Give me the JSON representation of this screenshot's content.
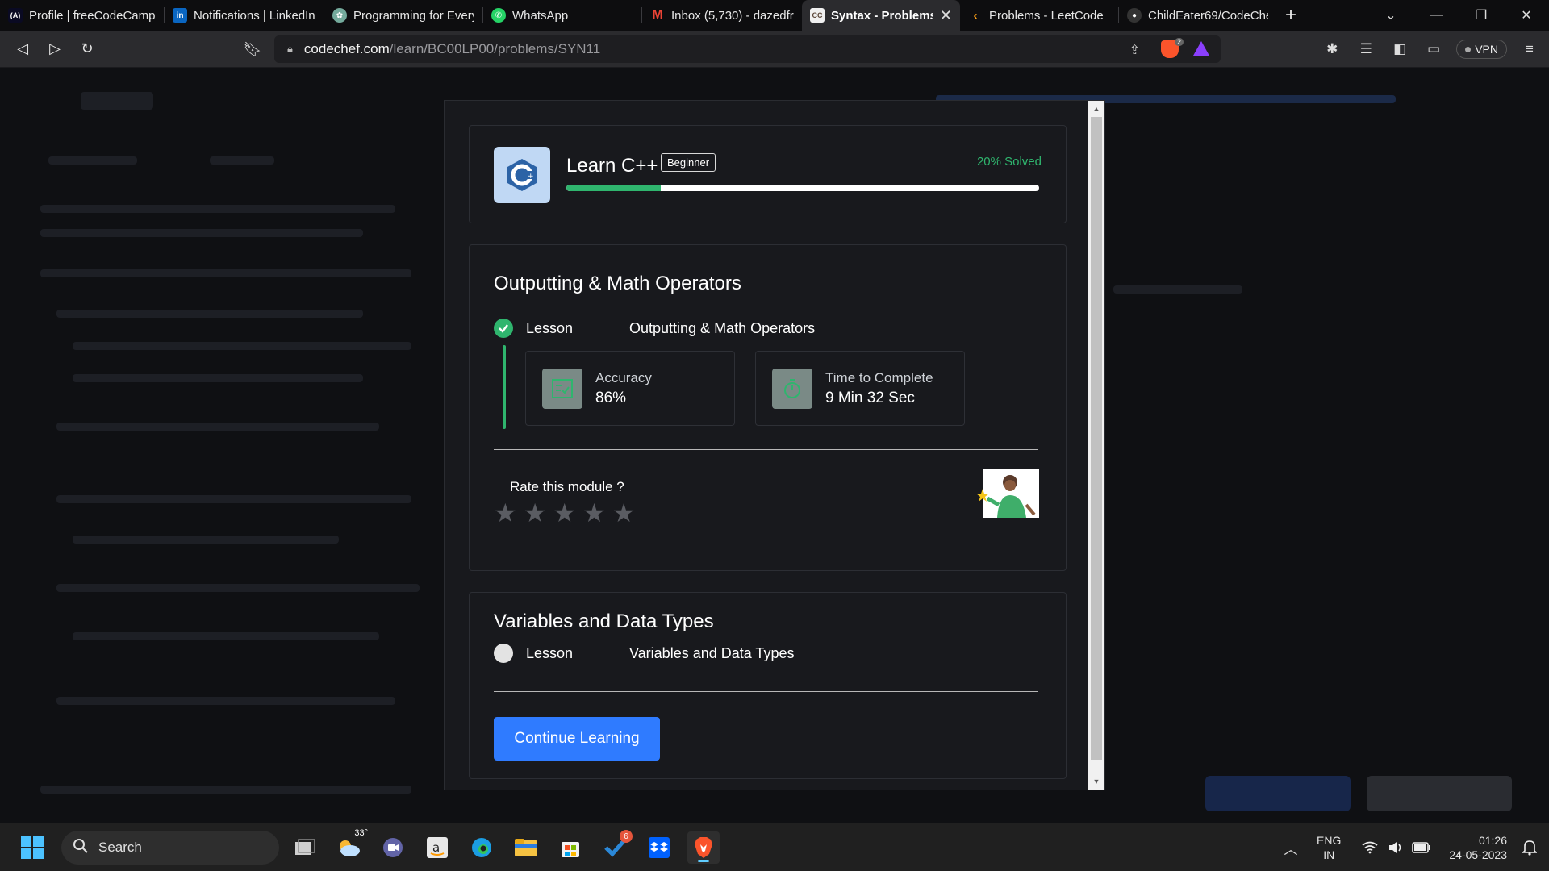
{
  "browser": {
    "tabs": [
      {
        "title": "Profile | freeCodeCamp",
        "icon": "freecodecamp-icon",
        "active": false
      },
      {
        "title": "Notifications | LinkedIn",
        "icon": "linkedin-icon",
        "active": false
      },
      {
        "title": "Programming for Every",
        "icon": "openai-icon",
        "active": false
      },
      {
        "title": "WhatsApp",
        "icon": "whatsapp-icon",
        "active": false
      },
      {
        "title": "Inbox (5,730) - dazedfr",
        "icon": "gmail-icon",
        "active": false
      },
      {
        "title": "Syntax - Problems",
        "icon": "codechef-icon",
        "active": true
      },
      {
        "title": "Problems - LeetCode",
        "icon": "leetcode-icon",
        "active": false
      },
      {
        "title": "ChildEater69/CodeChe",
        "icon": "github-icon",
        "active": false
      }
    ],
    "url_domain": "codechef.com",
    "url_path": "/learn/BC00LP00/problems/SYN11",
    "shields_badge": "2",
    "vpn_label": "VPN"
  },
  "course": {
    "title": "Learn C++",
    "level": "Beginner",
    "solved_text": "20% Solved",
    "progress_fraction": 0.2
  },
  "module": {
    "title": "Outputting & Math Operators",
    "lesson_type": "Lesson",
    "lesson_name": "Outputting & Math Operators",
    "lesson_completed": true,
    "stats": [
      {
        "label": "Accuracy",
        "value": "86%",
        "icon": "accuracy-icon"
      },
      {
        "label": "Time to Complete",
        "value": "9 Min 32 Sec",
        "icon": "stopwatch-icon"
      }
    ],
    "rate_prompt": "Rate this module ?",
    "rating_max": 5,
    "rating_value": 0
  },
  "next_module": {
    "title": "Variables and Data Types",
    "lesson_type": "Lesson",
    "lesson_name": "Variables and Data Types",
    "lesson_completed": false,
    "continue_label": "Continue Learning"
  },
  "taskbar": {
    "search_label": "Search",
    "weather_temp": "33°",
    "todo_badge": "6",
    "lang_top": "ENG",
    "lang_bottom": "IN",
    "time": "01:26",
    "date": "24-05-2023"
  },
  "colors": {
    "accent_green": "#2fb56e",
    "button_blue": "#2f7bff",
    "modal_bg": "#18191d"
  }
}
